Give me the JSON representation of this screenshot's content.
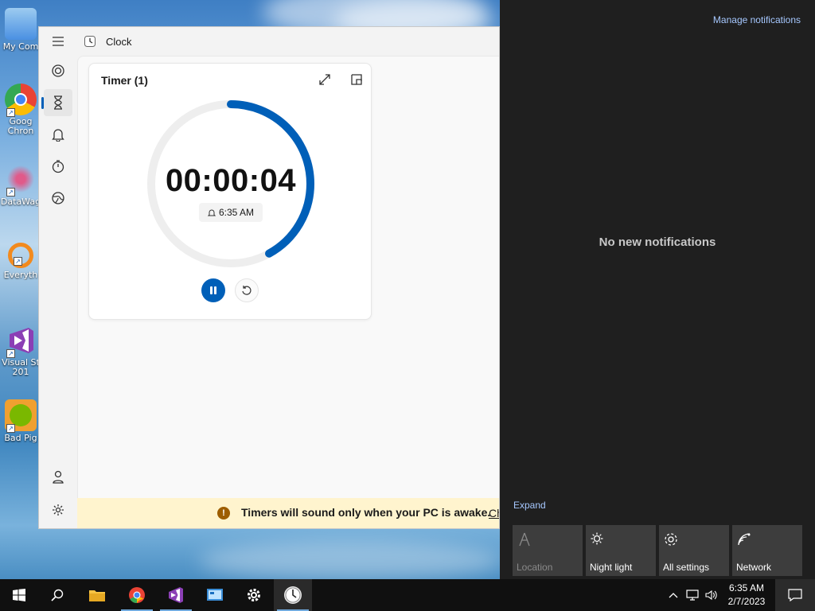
{
  "desktop": {
    "icons": [
      {
        "label": "My Com",
        "color": "#4a90e2"
      },
      {
        "label": "Goog Chron",
        "color": "#e94235"
      },
      {
        "label": "DataWag",
        "color": "#c0457a"
      },
      {
        "label": "Everyth",
        "color": "#f28a1e"
      },
      {
        "label": "Visual St 201",
        "color": "#7a2ea8"
      },
      {
        "label": "Bad Pig",
        "color": "#7ab800"
      }
    ]
  },
  "clock": {
    "app_title": "Clock",
    "nav": [
      {
        "name": "focus-sessions",
        "icon": "focus-icon"
      },
      {
        "name": "timer",
        "icon": "hourglass-icon",
        "active": true
      },
      {
        "name": "alarm",
        "icon": "bell-icon"
      },
      {
        "name": "stopwatch",
        "icon": "stopwatch-icon"
      },
      {
        "name": "world-clock",
        "icon": "globe-icon"
      }
    ],
    "timer": {
      "name": "Timer (1)",
      "time": "00:00:04",
      "alarm_time": "6:35 AM",
      "progress": 0.42
    },
    "info_bar": {
      "text": "Timers will sound only when your PC is awake.",
      "link": "Change p"
    }
  },
  "action_center": {
    "manage": "Manage notifications",
    "empty": "No new notifications",
    "expand": "Expand",
    "tiles": [
      {
        "label": "Location",
        "icon": "location-icon",
        "enabled": false
      },
      {
        "label": "Night light",
        "icon": "night-light-icon",
        "enabled": true
      },
      {
        "label": "All settings",
        "icon": "gear-icon",
        "enabled": true
      },
      {
        "label": "Network",
        "icon": "network-icon",
        "enabled": true
      }
    ]
  },
  "taskbar": {
    "time": "6:35 AM",
    "date": "2/7/2023",
    "accent": "#005fb8"
  }
}
